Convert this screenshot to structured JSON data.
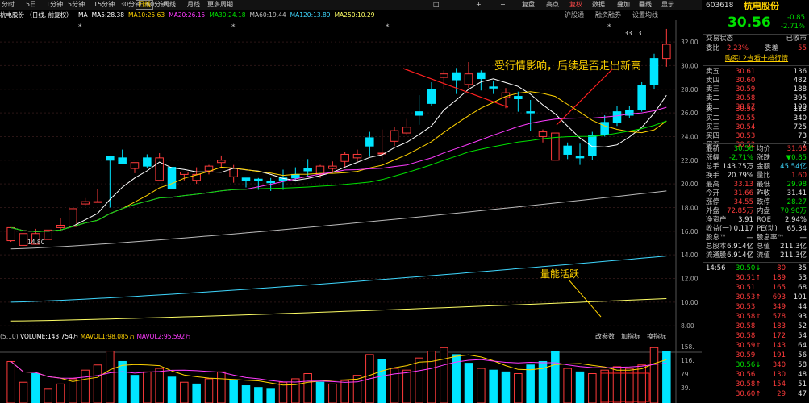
{
  "toolbar": {
    "items": [
      "分时",
      "5日",
      "1分钟",
      "5分钟",
      "15分钟",
      "30分钟",
      "60分钟",
      "日线",
      "周线",
      "月线",
      "更多周期"
    ],
    "active": "日线",
    "right_items": [
      "复盘",
      "高点",
      "复权",
      "数据",
      "叠加",
      "画线",
      "显示",
      "隐藏"
    ],
    "adjust_label": "复权"
  },
  "stock": {
    "name": "杭电股份",
    "chart_title": "杭电股份 （日线, 前复权）",
    "code": "603618",
    "price": "30.56",
    "change": "-0.85",
    "change_pct": "-2.71%",
    "status_label": "交易状态",
    "status_value": "已收市"
  },
  "ma_indicators": [
    {
      "label": "MA",
      "color": "#ffffff"
    },
    {
      "label": "MA5:28.38",
      "color": "#ffffff"
    },
    {
      "label": "MA10:25.63",
      "color": "#ffd200"
    },
    {
      "label": "MA20:26.15",
      "color": "#ff3bff"
    },
    {
      "label": "MA30:24.18",
      "color": "#00e000"
    },
    {
      "label": "MA60:19.44",
      "color": "#bbbbbb"
    },
    {
      "label": "MA120:13.89",
      "color": "#3fd8ff"
    },
    {
      "label": "MA250:10.29",
      "color": "#ffff66"
    }
  ],
  "chart_tabs": [
    "沪股通",
    "融资融券",
    "设置均线"
  ],
  "annotations": {
    "main": "受行情影响，后续是否走出新高",
    "volume": "量能活跃",
    "high_marker": "33.13",
    "low_marker": "14.80"
  },
  "volume_header": {
    "label": "VOLUME:143.754万",
    "mavol1": "MAVOL1:98.085万",
    "mavol2": "MAVOL2:95.592万",
    "params": "(5,10)",
    "right": [
      "改参数",
      "加指标",
      "换指标"
    ]
  },
  "colors": {
    "up": "#ff3b3b",
    "down": "#00e5ff",
    "bg": "#000000"
  },
  "chart_data": {
    "type": "candlestick",
    "ylim": [
      8,
      33
    ],
    "y_ticks": [
      8,
      10,
      12,
      14,
      16,
      18,
      20,
      22,
      24,
      26,
      28,
      30,
      32
    ],
    "y_tick_labels": [
      "8.00",
      "10.00",
      "12.00",
      "14.00",
      "16.00",
      "18.00",
      "20.00",
      "22.00",
      "24.00",
      "26.00",
      "28.00",
      "30.00",
      "32.00"
    ],
    "vol_ticks": [
      "158.",
      "116.",
      "79.",
      "39."
    ],
    "candles": [
      [
        15.6,
        16.3,
        15.2,
        15.1
      ],
      [
        15.7,
        15.8,
        14.8,
        15.6
      ],
      [
        16.2,
        15.8,
        14.9,
        15.4
      ],
      [
        16.0,
        16.1,
        15.3,
        15.9
      ],
      [
        17.1,
        16.5,
        16.3,
        16.0
      ],
      [
        17.9,
        17.9,
        16.4,
        17.2
      ],
      [
        18.8,
        18.5,
        18.3,
        18.1
      ],
      [
        19.6,
        18.5,
        18.5,
        18.6
      ],
      [
        21.8,
        22.0,
        22.3,
        18.0
      ],
      [
        22.9,
        21.7,
        22.2,
        21.8
      ],
      [
        21.7,
        21.8,
        21.3,
        20.9
      ],
      [
        22.5,
        21.5,
        22.2,
        21.3
      ],
      [
        22.6,
        22.2,
        20.3,
        21.4
      ],
      [
        20.8,
        19.6,
        21.4,
        20.5
      ],
      [
        20.9,
        21.0,
        20.8,
        20.3
      ],
      [
        21.4,
        20.8,
        20.3,
        20.0
      ],
      [
        21.6,
        21.5,
        21.1,
        20.8
      ],
      [
        22.4,
        22.0,
        21.8,
        21.4
      ],
      [
        21.6,
        21.3,
        20.6,
        20.1
      ],
      [
        20.5,
        20.3,
        20.5,
        19.7
      ],
      [
        20.5,
        20.3,
        20.4,
        19.5
      ],
      [
        20.5,
        20.1,
        20.2,
        19.4
      ],
      [
        21.2,
        20.3,
        20.5,
        19.5
      ],
      [
        21.4,
        20.5,
        20.8,
        20.2
      ],
      [
        22.1,
        21.1,
        21.3,
        20.6
      ],
      [
        21.6,
        21.5,
        20.8,
        20.5
      ],
      [
        21.9,
        21.5,
        21.3,
        21.0
      ],
      [
        22.7,
        22.5,
        21.9,
        21.4
      ],
      [
        22.9,
        22.5,
        22.2,
        21.9
      ],
      [
        24.4,
        23.2,
        23.9,
        22.3
      ],
      [
        24.6,
        22.6,
        22.6,
        22.0
      ],
      [
        24.8,
        24.5,
        23.6,
        23.2
      ],
      [
        25.5,
        24.8,
        24.3,
        24.1
      ],
      [
        27.5,
        25.8,
        26.1,
        25.0
      ],
      [
        28.6,
        26.8,
        28.0,
        26.6
      ],
      [
        29.6,
        29.3,
        29.0,
        28.0
      ],
      [
        29.8,
        28.8,
        29.4,
        27.6
      ],
      [
        30.3,
        29.3,
        28.4,
        28.1
      ],
      [
        29.6,
        28.9,
        29.4,
        27.9
      ],
      [
        28.7,
        28.1,
        28.2,
        27.6
      ],
      [
        28.1,
        27.7,
        27.3,
        26.4
      ],
      [
        27.8,
        27.2,
        27.4,
        26.1
      ],
      [
        27.1,
        26.0,
        26.1,
        24.5
      ],
      [
        24.6,
        24.4,
        24.0,
        23.5
      ],
      [
        24.2,
        24.3,
        22.0,
        22.1
      ],
      [
        23.5,
        22.5,
        23.2,
        22.1
      ],
      [
        23.4,
        22.2,
        22.3,
        21.6
      ],
      [
        24.4,
        22.4,
        24.1,
        22.0
      ],
      [
        25.8,
        24.2,
        25.2,
        24.0
      ],
      [
        26.6,
        25.2,
        26.1,
        24.9
      ],
      [
        26.6,
        25.8,
        26.2,
        25.6
      ],
      [
        28.6,
        26.3,
        28.3,
        26.1
      ],
      [
        31.0,
        28.4,
        30.6,
        28.0
      ],
      [
        33.1,
        31.8,
        30.6,
        29.9
      ]
    ],
    "volumes": [
      120,
      60,
      85,
      40,
      55,
      70,
      95,
      110,
      150,
      120,
      80,
      90,
      100,
      75,
      60,
      55,
      70,
      90,
      65,
      50,
      45,
      40,
      60,
      70,
      85,
      60,
      55,
      65,
      80,
      140,
      125,
      100,
      95,
      130,
      150,
      160,
      140,
      115,
      100,
      95,
      90,
      85,
      110,
      120,
      150,
      100,
      90,
      85,
      95,
      105,
      100,
      110,
      160,
      150
    ],
    "vol_up": [
      true,
      true,
      false,
      true,
      true,
      true,
      true,
      true,
      true,
      false,
      false,
      true,
      true,
      false,
      true,
      false,
      true,
      true,
      false,
      false,
      false,
      false,
      true,
      true,
      true,
      false,
      true,
      true,
      true,
      true,
      false,
      true,
      true,
      true,
      true,
      true,
      false,
      false,
      true,
      false,
      false,
      true,
      false,
      false,
      false,
      true,
      false,
      true,
      true,
      true,
      true,
      true,
      true,
      false
    ]
  },
  "quote_panel": {
    "wei_bi": {
      "label": "委比",
      "value": "2.23%",
      "label2": "委差",
      "value2": "55"
    },
    "level2_link": "购买L2查看十档行情",
    "asks": [
      {
        "label": "卖五",
        "price": "30.61",
        "vol": "136"
      },
      {
        "label": "卖四",
        "price": "30.60",
        "vol": "482"
      },
      {
        "label": "卖三",
        "price": "30.59",
        "vol": "188"
      },
      {
        "label": "卖二",
        "price": "30.58",
        "vol": "395"
      },
      {
        "label": "卖一",
        "price": "30.57",
        "vol": "100"
      }
    ],
    "bids": [
      {
        "label": "买一",
        "price": "30.56",
        "vol": "113"
      },
      {
        "label": "买二",
        "price": "30.55",
        "vol": "340"
      },
      {
        "label": "买三",
        "price": "30.54",
        "vol": "725"
      },
      {
        "label": "买四",
        "price": "30.53",
        "vol": "73"
      },
      {
        "label": "买五",
        "price": "30.52",
        "vol": "7"
      }
    ],
    "stats": [
      {
        "l1": "最新",
        "v1": "30.56",
        "c1": "green",
        "l2": "均价",
        "v2": "31.68",
        "c2": "red"
      },
      {
        "l1": "涨幅",
        "v1": "-2.71%",
        "c1": "green",
        "l2": "涨跌",
        "v2": "▼0.85",
        "c2": "green"
      },
      {
        "l1": "总手",
        "v1": "143.75万",
        "c1": "white",
        "l2": "金额",
        "v2": "45.54亿",
        "c2": "cyan"
      },
      {
        "l1": "换手",
        "v1": "20.79%",
        "c1": "white",
        "l2": "量比",
        "v2": "1.60",
        "c2": "red"
      },
      {
        "l1": "最高",
        "v1": "33.13",
        "c1": "red",
        "l2": "最低",
        "v2": "29.98",
        "c2": "green"
      },
      {
        "l1": "今开",
        "v1": "31.66",
        "c1": "red",
        "l2": "昨收",
        "v2": "31.41",
        "c2": "white"
      },
      {
        "l1": "涨停",
        "v1": "34.55",
        "c1": "red",
        "l2": "跌停",
        "v2": "28.27",
        "c2": "green"
      },
      {
        "l1": "外盘",
        "v1": "72.85万",
        "c1": "red",
        "l2": "内盘",
        "v2": "70.90万",
        "c2": "green"
      },
      {
        "l1": "净资产",
        "v1": "3.91",
        "c1": "white",
        "l2": "ROE",
        "v2": "2.94%",
        "c2": "white"
      },
      {
        "l1": "收益(一)",
        "v1": "0.117",
        "c1": "white",
        "l2": "PE(动)",
        "v2": "65.34",
        "c2": "white"
      },
      {
        "l1": "股息™",
        "v1": "—",
        "c1": "white",
        "l2": "股息率™",
        "v2": "—",
        "c2": "white"
      },
      {
        "l1": "总股本",
        "v1": "6.914亿",
        "c1": "white",
        "l2": "总值",
        "v2": "211.3亿",
        "c2": "white"
      },
      {
        "l1": "流通股",
        "v1": "6.914亿",
        "c1": "white",
        "l2": "流值",
        "v2": "211.3亿",
        "c2": "white"
      }
    ],
    "ticks": [
      {
        "time": "14:56",
        "price": "30.50",
        "arrow": "↓",
        "vol": "80",
        "n": "35"
      },
      {
        "time": "",
        "price": "30.51",
        "arrow": "↑",
        "vol": "189",
        "n": "53"
      },
      {
        "time": "",
        "price": "30.51",
        "arrow": "",
        "vol": "165",
        "n": "68"
      },
      {
        "time": "",
        "price": "30.53",
        "arrow": "↑",
        "vol": "693",
        "n": "101"
      },
      {
        "time": "",
        "price": "30.53",
        "arrow": "",
        "vol": "349",
        "n": "44"
      },
      {
        "time": "",
        "price": "30.58",
        "arrow": "↑",
        "vol": "578",
        "n": "93"
      },
      {
        "time": "",
        "price": "30.58",
        "arrow": "",
        "vol": "183",
        "n": "52"
      },
      {
        "time": "",
        "price": "30.58",
        "arrow": "",
        "vol": "172",
        "n": "54"
      },
      {
        "time": "",
        "price": "30.59",
        "arrow": "↑",
        "vol": "143",
        "n": "64"
      },
      {
        "time": "",
        "price": "30.59",
        "arrow": "",
        "vol": "191",
        "n": "56"
      },
      {
        "time": "",
        "price": "30.56",
        "arrow": "↓",
        "vol": "340",
        "n": "58"
      },
      {
        "time": "",
        "price": "30.56",
        "arrow": "",
        "vol": "130",
        "n": "48"
      },
      {
        "time": "",
        "price": "30.58",
        "arrow": "↑",
        "vol": "154",
        "n": "51"
      },
      {
        "time": "",
        "price": "30.60",
        "arrow": "↑",
        "vol": "29",
        "n": "47"
      }
    ]
  }
}
